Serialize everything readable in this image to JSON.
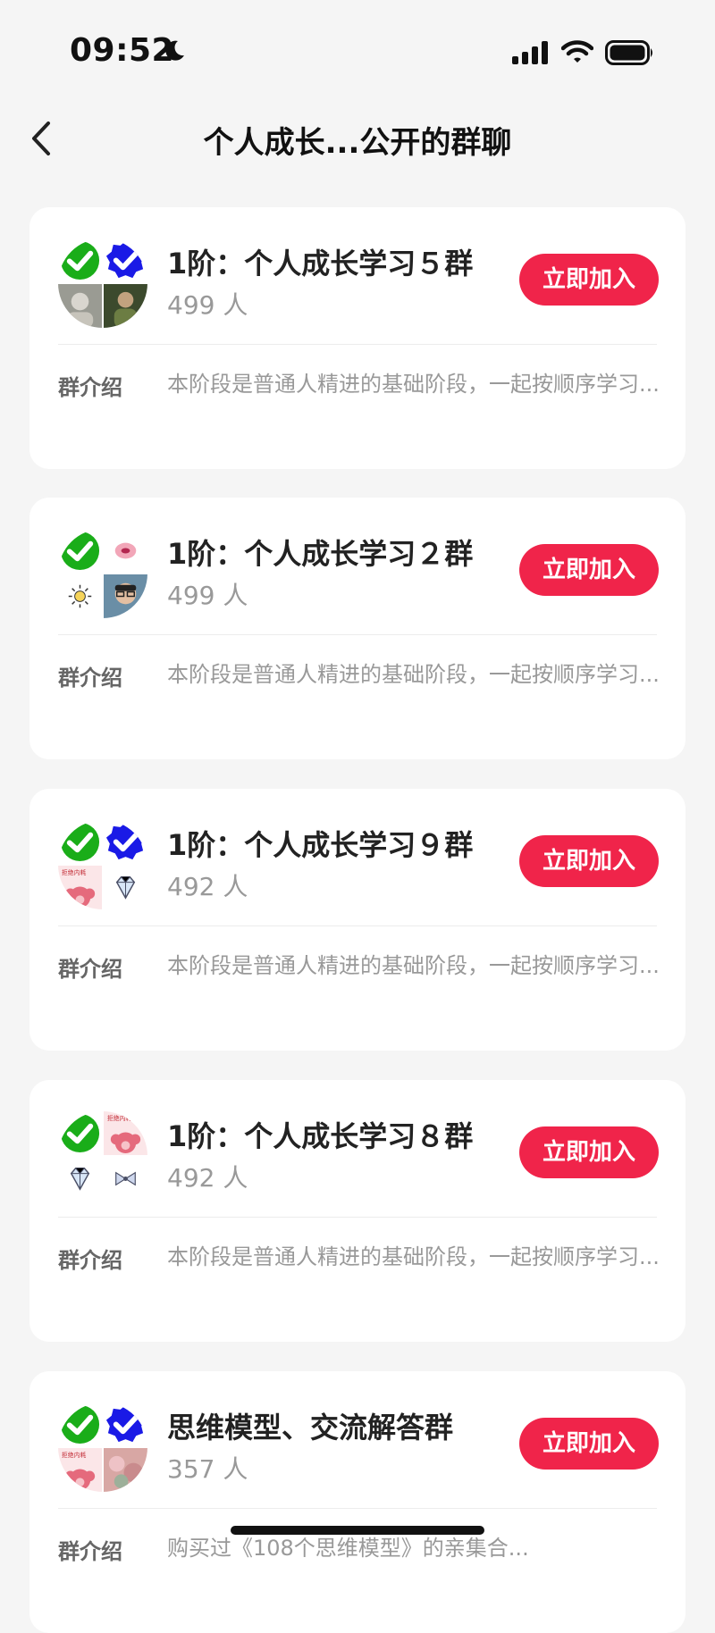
{
  "status_bar": {
    "time": "09:52",
    "icons": [
      "moon-icon",
      "signal-icon",
      "wifi-icon",
      "battery-icon"
    ]
  },
  "nav": {
    "title": "个人成长...公开的群聊",
    "back_icon": "chevron-left-icon"
  },
  "colors": {
    "accent": "#f0244a",
    "card_bg": "#ffffff",
    "page_bg": "#f5f5f5",
    "check_green": "#1aad19",
    "check_blue": "#1a1ae6"
  },
  "groups": [
    {
      "name": "1阶：个人成长学习５群",
      "members": "499 人",
      "join_label": "立即加入",
      "intro_label": "群介绍",
      "intro": "本阶段是普通人精进的基础阶段，一起按顺序学习..."
    },
    {
      "name": "1阶：个人成长学习２群",
      "members": "499 人",
      "join_label": "立即加入",
      "intro_label": "群介绍",
      "intro": "本阶段是普通人精进的基础阶段，一起按顺序学习..."
    },
    {
      "name": "1阶：个人成长学习９群",
      "members": "492 人",
      "join_label": "立即加入",
      "intro_label": "群介绍",
      "intro": "本阶段是普通人精进的基础阶段，一起按顺序学习..."
    },
    {
      "name": "1阶：个人成长学习８群",
      "members": "492 人",
      "join_label": "立即加入",
      "intro_label": "群介绍",
      "intro": "本阶段是普通人精进的基础阶段，一起按顺序学习..."
    },
    {
      "name": "思维模型、交流解答群",
      "members": "357 人",
      "join_label": "立即加入",
      "intro_label": "群介绍",
      "intro": "购买过《108个思维模型》的亲集合..."
    }
  ]
}
